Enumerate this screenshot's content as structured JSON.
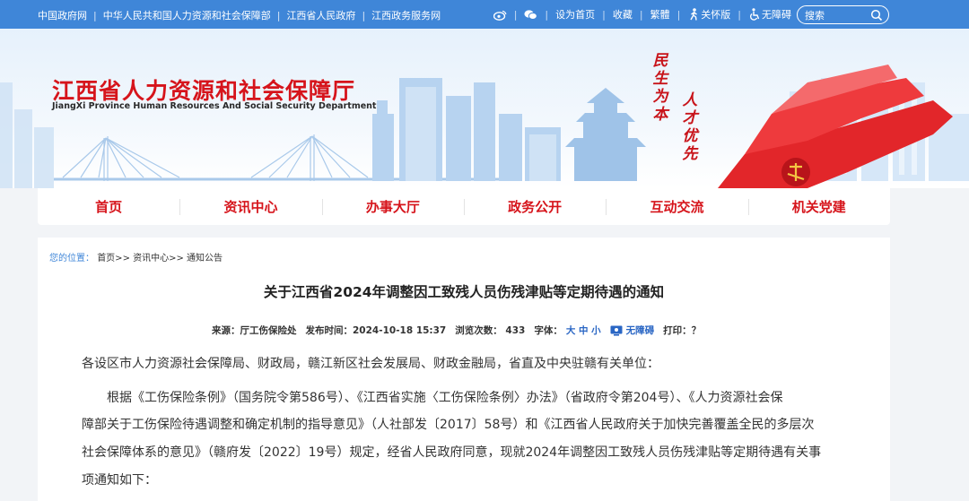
{
  "topbar": {
    "links": [
      "中国政府网",
      "中华人民共和国人力资源和社会保障部",
      "江西省人民政府",
      "江西政务服务网"
    ],
    "right": [
      "设为首页",
      "收藏",
      "繁體",
      "关怀版",
      "无障碍"
    ],
    "search_label": "搜索"
  },
  "header": {
    "title": "江西省人力资源和社会保障厅",
    "subtitle": "JiangXi Province Human Resources And Social Security Department",
    "slogan_left": "民生为本",
    "slogan_right": "人才优先"
  },
  "nav": [
    "首页",
    "资讯中心",
    "办事大厅",
    "政务公开",
    "互动交流",
    "机关党建"
  ],
  "breadcrumb": {
    "label": "您的位置：",
    "path": "首页>> 资讯中心>> 通知公告"
  },
  "article": {
    "title": "关于江西省2024年调整因工致残人员伤残津贴等定期待遇的通知",
    "meta": {
      "source": "来源：厅工伤保险处",
      "date": "发布时间：2024-10-18 15:37",
      "views": "浏览次数：  433",
      "font": "字体：",
      "font_sizes": "大 中 小",
      "accessible": "无障碍",
      "print": "打印：？"
    },
    "paragraphs": [
      "各设区市人力资源社会保障局、财政局，赣江新区社会发展局、财政金融局，省直及中央驻赣有关单位：",
      "根据《工伤保险条例》（国务院令第586号）、《江西省实施〈工伤保险条例〉办法》（省政府令第204号）、《人力资源社会保",
      "障部关于工伤保险待遇调整和确定机制的指导意见》（人社部发〔2017〕58号）和《江西省人民政府关于加快完善覆盖全民的多层次",
      "社会保障体系的意见》（赣府发〔2022〕19号）规定，经省人民政府同意，现就2024年调整因工致残人员伤残津贴等定期待遇有关事",
      "项通知如下："
    ]
  },
  "colors": {
    "brand_red": "#d6141b",
    "top_blue": "#3f86d8"
  }
}
